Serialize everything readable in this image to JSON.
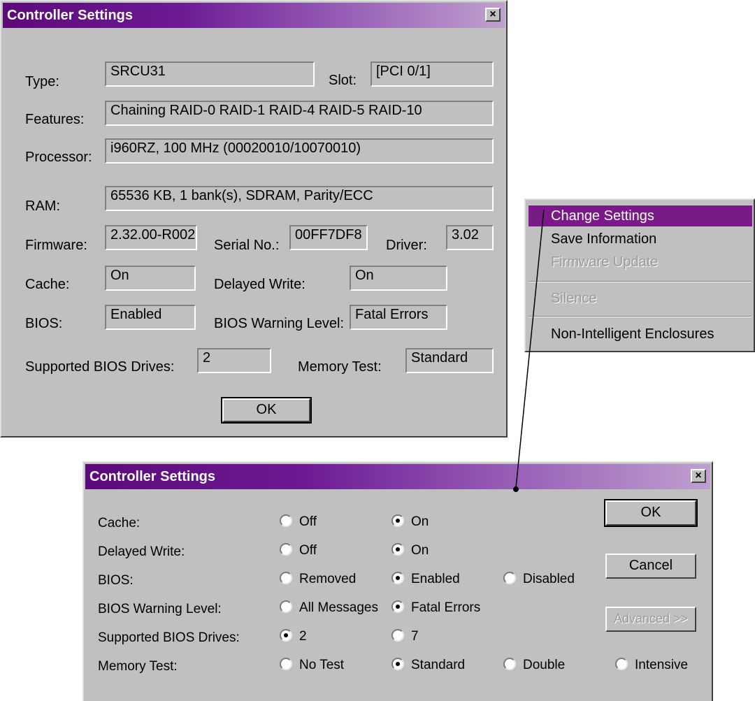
{
  "dialog1": {
    "title": "Controller Settings",
    "close": "×",
    "labels": {
      "type": "Type:",
      "slot": "Slot:",
      "features": "Features:",
      "processor": "Processor:",
      "ram": "RAM:",
      "firmware": "Firmware:",
      "serial": "Serial No.:",
      "driver": "Driver:",
      "cache": "Cache:",
      "delayed_write": "Delayed Write:",
      "bios": "BIOS:",
      "bios_warning": "BIOS Warning Level:",
      "supported_bios": "Supported BIOS Drives:",
      "memory_test": "Memory Test:"
    },
    "values": {
      "type": "SRCU31",
      "slot": "[PCI 0/1]",
      "features": "Chaining RAID-0 RAID-1 RAID-4 RAID-5 RAID-10",
      "processor": "i960RZ, 100 MHz (00020010/10070010)",
      "ram": "65536 KB, 1 bank(s), SDRAM, Parity/ECC",
      "firmware": "2.32.00-R002",
      "serial": "00FF7DF8",
      "driver": "3.02",
      "cache": "On",
      "delayed_write": "On",
      "bios": "Enabled",
      "bios_warning": "Fatal Errors",
      "supported_bios": "2",
      "memory_test": "Standard"
    },
    "ok": "OK"
  },
  "menu": {
    "items": [
      {
        "label": "Change Settings",
        "state": "selected"
      },
      {
        "label": "Save Information",
        "state": "normal"
      },
      {
        "label": "Firmware Update",
        "state": "disabled"
      },
      {
        "label": "Silence",
        "state": "disabled"
      },
      {
        "label": "Non-Intelligent Enclosures",
        "state": "normal"
      }
    ]
  },
  "dialog2": {
    "title": "Controller Settings",
    "close": "×",
    "rows": [
      {
        "label": "Cache:",
        "options": [
          "Off",
          "On"
        ],
        "selected": 1
      },
      {
        "label": "Delayed Write:",
        "options": [
          "Off",
          "On"
        ],
        "selected": 1
      },
      {
        "label": "BIOS:",
        "options": [
          "Removed",
          "Enabled",
          "Disabled"
        ],
        "selected": 1
      },
      {
        "label": "BIOS Warning Level:",
        "options": [
          "All Messages",
          "Fatal Errors"
        ],
        "selected": 1
      },
      {
        "label": "Supported BIOS Drives:",
        "options": [
          "2",
          "7"
        ],
        "selected": 0
      },
      {
        "label": "Memory Test:",
        "options": [
          "No Test",
          "Standard",
          "Double",
          "Intensive"
        ],
        "selected": 1
      }
    ],
    "buttons": {
      "ok": "OK",
      "cancel": "Cancel",
      "advanced": "Advanced >>"
    }
  }
}
